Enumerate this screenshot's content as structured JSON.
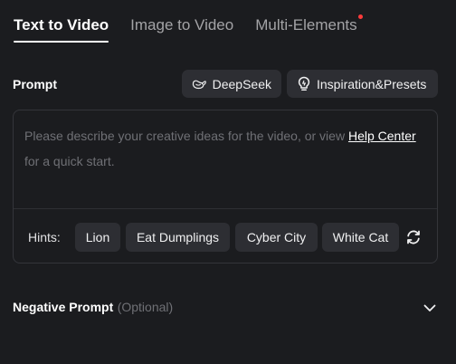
{
  "tabs": [
    {
      "label": "Text to Video",
      "active": true
    },
    {
      "label": "Image to Video",
      "active": false
    },
    {
      "label": "Multi-Elements",
      "active": false,
      "badge_dot": true
    }
  ],
  "prompt": {
    "label": "Prompt",
    "deepseek_label": "DeepSeek",
    "inspiration_label": "Inspiration&Presets",
    "placeholder_before": "Please describe your creative ideas for the video, or view ",
    "help_link": "Help Center",
    "placeholder_after": " for a quick start."
  },
  "hints": {
    "label": "Hints:",
    "chips": [
      "Lion",
      "Eat Dumplings",
      "Cyber City",
      "White Cat"
    ]
  },
  "negative_prompt": {
    "label": "Negative Prompt",
    "optional": "(Optional)"
  },
  "colors": {
    "background": "#1b1c1f",
    "chip_bg": "#2d2e33",
    "badge_dot": "#ff3b3b",
    "placeholder": "#6f7075"
  }
}
